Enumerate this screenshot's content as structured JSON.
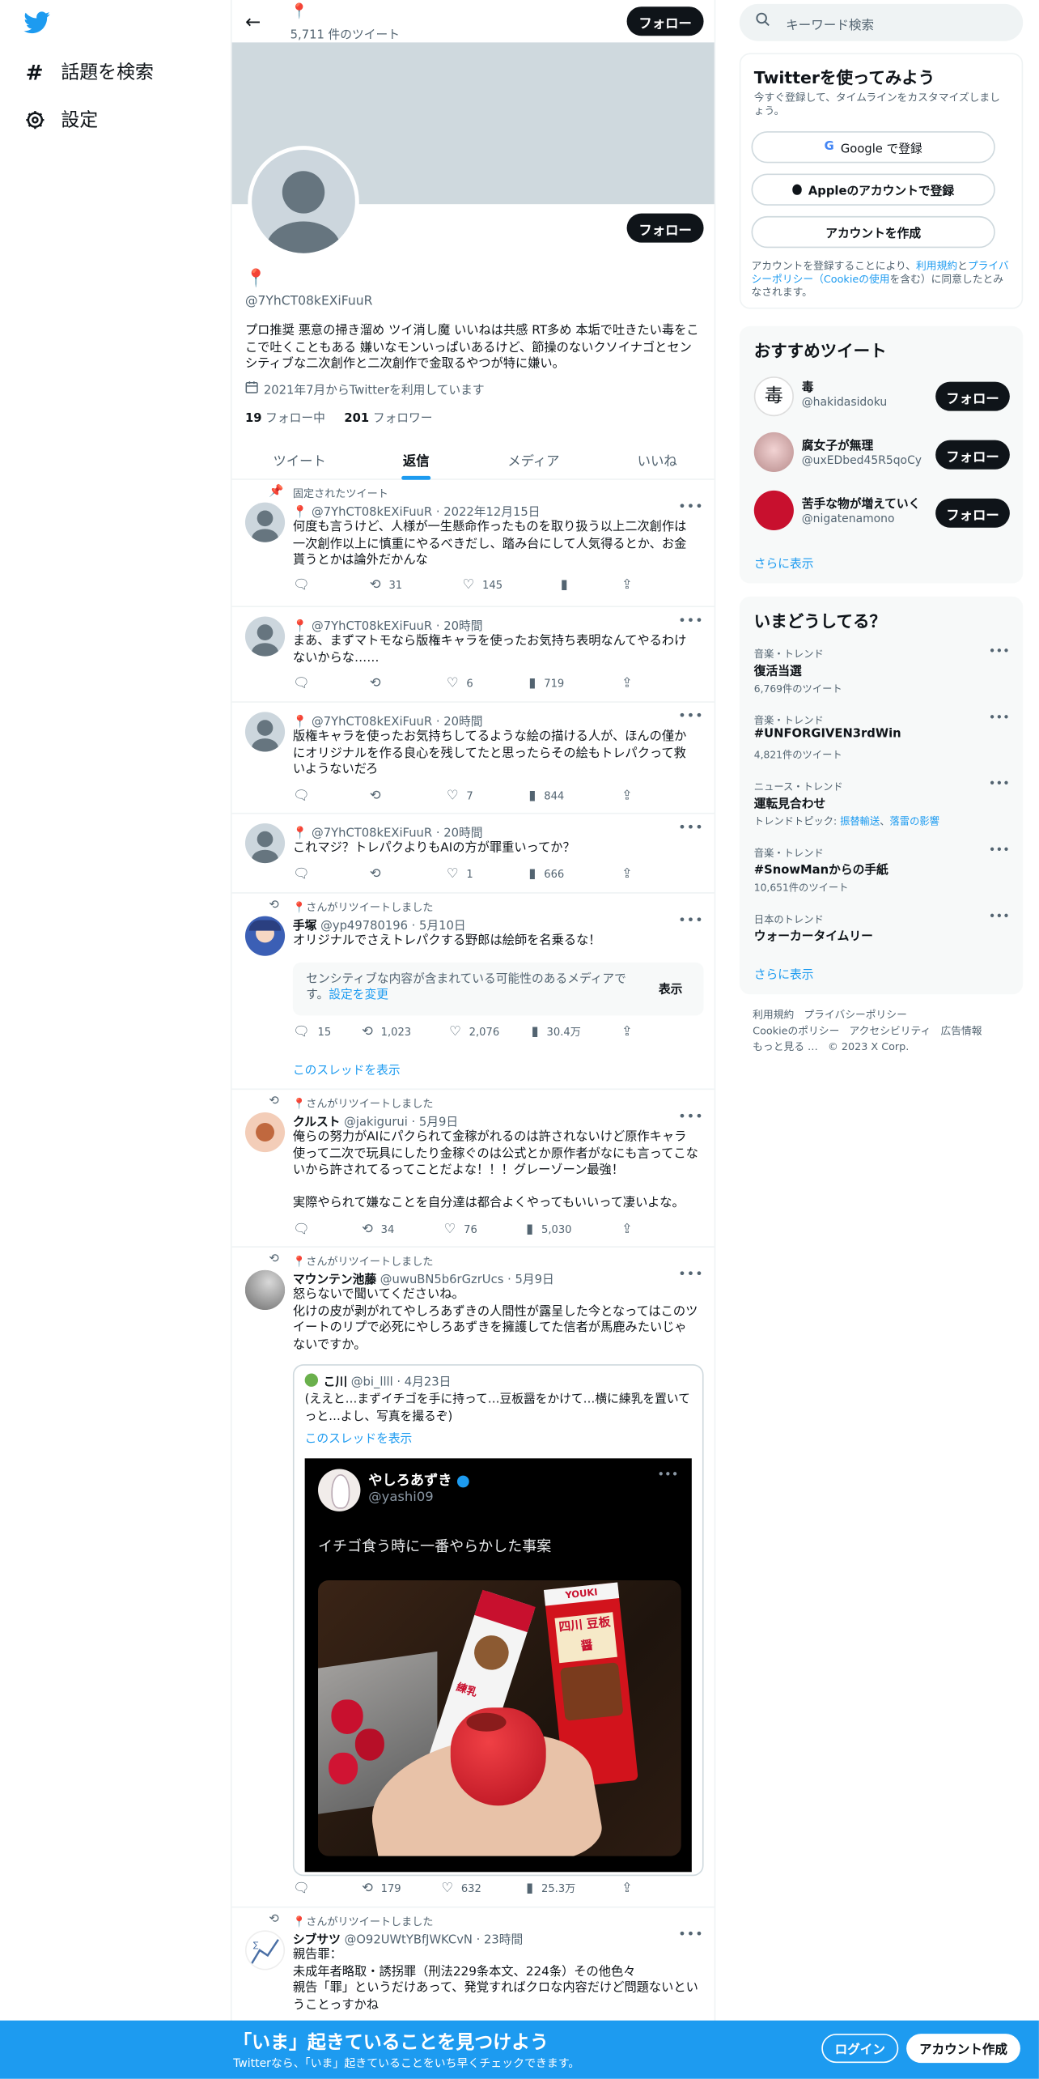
{
  "nav": {
    "explore_label": "話題を検索",
    "settings_label": "設定"
  },
  "header": {
    "name_emoji": "📍",
    "tweet_count": "5,711 件のツイート",
    "follow_label": "フォロー"
  },
  "profile": {
    "name_emoji": "📍",
    "handle": "@7YhCT08kEXiFuuR",
    "bio": "プロ推奨 悪意の掃き溜め ツイ消し魔 いいねは共感 RT多め 本垢で吐きたい毒をここで吐くこともある 嫌いなモンいっぱいあるけど、節操のないクソイナゴとセンシティブな二次創作と二次創作で金取るやつが特に嫌い。",
    "joined": "2021年7月からTwitterを利用しています",
    "following_count": "19",
    "following_label": "フォロー中",
    "followers_count": "201",
    "followers_label": "フォロワー",
    "follow_label": "フォロー"
  },
  "tabs": [
    {
      "label": "ツイート"
    },
    {
      "label": "返信"
    },
    {
      "label": "メディア"
    },
    {
      "label": "いいね"
    }
  ],
  "tweets": [
    {
      "context": "固定されたツイート",
      "name": "📍",
      "handle": "@7YhCT08kEXiFuuR",
      "time": "2022年12月15日",
      "text": "何度も言うけど、人様が一生懸命作ったものを取り扱う以上二次創作は一次創作以上に慎重にやるべきだし、踏み台にして人気得るとか、お金貰うとかは論外だかんな",
      "replies": "",
      "retweets": "31",
      "likes": "145",
      "views": ""
    },
    {
      "name": "📍",
      "handle": "@7YhCT08kEXiFuuR",
      "time": "20時間",
      "text": "まあ、まずマトモなら版権キャラを使ったお気持ち表明なんてやるわけないからな……",
      "replies": "",
      "retweets": "",
      "likes": "6",
      "views": "719"
    },
    {
      "name": "📍",
      "handle": "@7YhCT08kEXiFuuR",
      "time": "20時間",
      "text": "版権キャラを使ったお気持ちしてるような絵の描ける人が、ほんの僅かにオリジナルを作る良心を残してたと思ったらその絵もトレパクって救いようないだろ",
      "replies": "",
      "retweets": "",
      "likes": "7",
      "views": "844"
    },
    {
      "name": "📍",
      "handle": "@7YhCT08kEXiFuuR",
      "time": "20時間",
      "text": "これマジ？トレパクよりもAIの方が罪重いってか？",
      "replies": "",
      "retweets": "",
      "likes": "1",
      "views": "666"
    },
    {
      "context": "📍さんがリツイートしました",
      "name": "手塚",
      "handle": "@yp49780196",
      "time": "5月10日",
      "text": "オリジナルでさえトレパクする野郎は絵師を名乗るな！",
      "sensitive_text": "センシティブな内容が含まれている可能性のあるメディアです。",
      "sensitive_link": "設定を変更",
      "show_label": "表示",
      "replies": "15",
      "retweets": "1,023",
      "likes": "2,076",
      "views": "30.4万",
      "thread_link": "このスレッドを表示"
    },
    {
      "context": "📍さんがリツイートしました",
      "name": "クルスト",
      "handle": "@jakigurui",
      "time": "5月9日",
      "text": "俺らの努力がAIにパクられて金稼がれるのは許されないけど原作キャラ使って二次で玩具にしたり金稼ぐのは公式とか原作者がなにも言ってこないから許されてるってことだよな！！！グレーゾーン最強！",
      "text2": "実際やられて嫌なことを自分達は都合よくやってもいいって凄いよな。",
      "replies": "",
      "retweets": "34",
      "likes": "76",
      "views": "5,030"
    },
    {
      "context": "📍さんがリツイートしました",
      "name": "マウンテン池藤",
      "handle": "@uwuBN5b6rGzrUcs",
      "time": "5月9日",
      "text": "怒らないで聞いてくださいね。\n化けの皮が剥がれてやしろあずきの人間性が露呈した今となってはこのツイートのリプで必死にやしろあずきを擁護してた信者が馬鹿みたいじゃないですか。",
      "quote_name": "こ川",
      "quote_handle": "@bi_llll",
      "quote_time": "4月23日",
      "quote_text": "(ええと…まずイチゴを手に持って…豆板醤をかけて…横に練乳を置いてっと…よし、写真を撮るぞ)",
      "quote_thread": "このスレッドを表示",
      "img_name": "やしろあずき",
      "img_handle": "@yashi09",
      "img_caption": "イチゴ食う時に一番やらかした事案",
      "img_tube1": "練乳",
      "img_tube2": "四川 豆板醤",
      "img_brand": "YOUKI",
      "replies": "",
      "retweets": "179",
      "likes": "632",
      "views": "25.3万"
    },
    {
      "context": "📍さんがリツイートしました",
      "name": "シブサツ",
      "handle": "@O92UWtYBfJWKCvN",
      "time": "23時間",
      "text": "親告罪：\n未成年者略取・誘拐罪（刑法229条本文、224条）その他色々\n親告「罪」というだけあって、発覚すればクロな内容だけど問題ないということっすかね"
    }
  ],
  "search": {
    "placeholder": "キーワード検索"
  },
  "signup": {
    "title": "Twitterを使ってみよう",
    "subtitle": "今すぐ登録して、タイムラインをカスタマイズしましょう。",
    "google": "Google で登録",
    "apple": "Appleのアカウントで登録",
    "create": "アカウントを作成",
    "terms_pre": "アカウントを登録することにより、",
    "terms_link": "利用規約",
    "terms_and": "と",
    "privacy_link": "プライバシーポリシー",
    "cookie_link": "（Cookieの使用",
    "terms_post": "を含む）に同意したとみなされます。"
  },
  "recommended": {
    "title": "おすすめツイート",
    "accounts": [
      {
        "name": "毒",
        "handle": "@hakidasidoku",
        "avatar_text": "毒"
      },
      {
        "name": "腐女子が無理",
        "handle": "@uxEDbed45R5qoCy",
        "avatar_text": ""
      },
      {
        "name": "苦手な物が増えていく",
        "handle": "@nigatenamono",
        "avatar_text": ""
      }
    ],
    "follow_label": "フォロー",
    "more": "さらに表示"
  },
  "trends": {
    "title": "いまどうしてる？",
    "items": [
      {
        "category": "音楽・トレンド",
        "name": "復活当選",
        "count": "6,769件のツイート"
      },
      {
        "category": "音楽・トレンド",
        "name": "#UNFORGIVEN3rdWin",
        "count": "4,821件のツイート"
      },
      {
        "category": "ニュース・トレンド",
        "name": "運転見合わせ",
        "topic_pre": "トレンドトピック: ",
        "topic1": "振替輸送",
        "topic_sep": "、",
        "topic2": "落雷の影響"
      },
      {
        "category": "音楽・トレンド",
        "name": "#SnowManからの手紙",
        "count": "10,651件のツイート"
      },
      {
        "category": "日本のトレンド",
        "name": "ウォーカータイムリー"
      }
    ],
    "more": "さらに表示"
  },
  "footer": {
    "terms": "利用規約",
    "privacy": "プライバシーポリシー",
    "cookie": "Cookieのポリシー",
    "accessibility": "アクセシビリティ",
    "ads": "広告情報",
    "more": "もっと見る …",
    "copyright": "© 2023 X Corp."
  },
  "bottom_bar": {
    "title": "「いま」起きていることを見つけよう",
    "subtitle": "Twitterなら、「いま」起きていることをいち早くチェックできます。",
    "login": "ログイン",
    "signup": "アカウント作成"
  },
  "colors": {
    "brand": "#1d9bf0",
    "dark": "#0f1419",
    "muted": "#536471"
  }
}
